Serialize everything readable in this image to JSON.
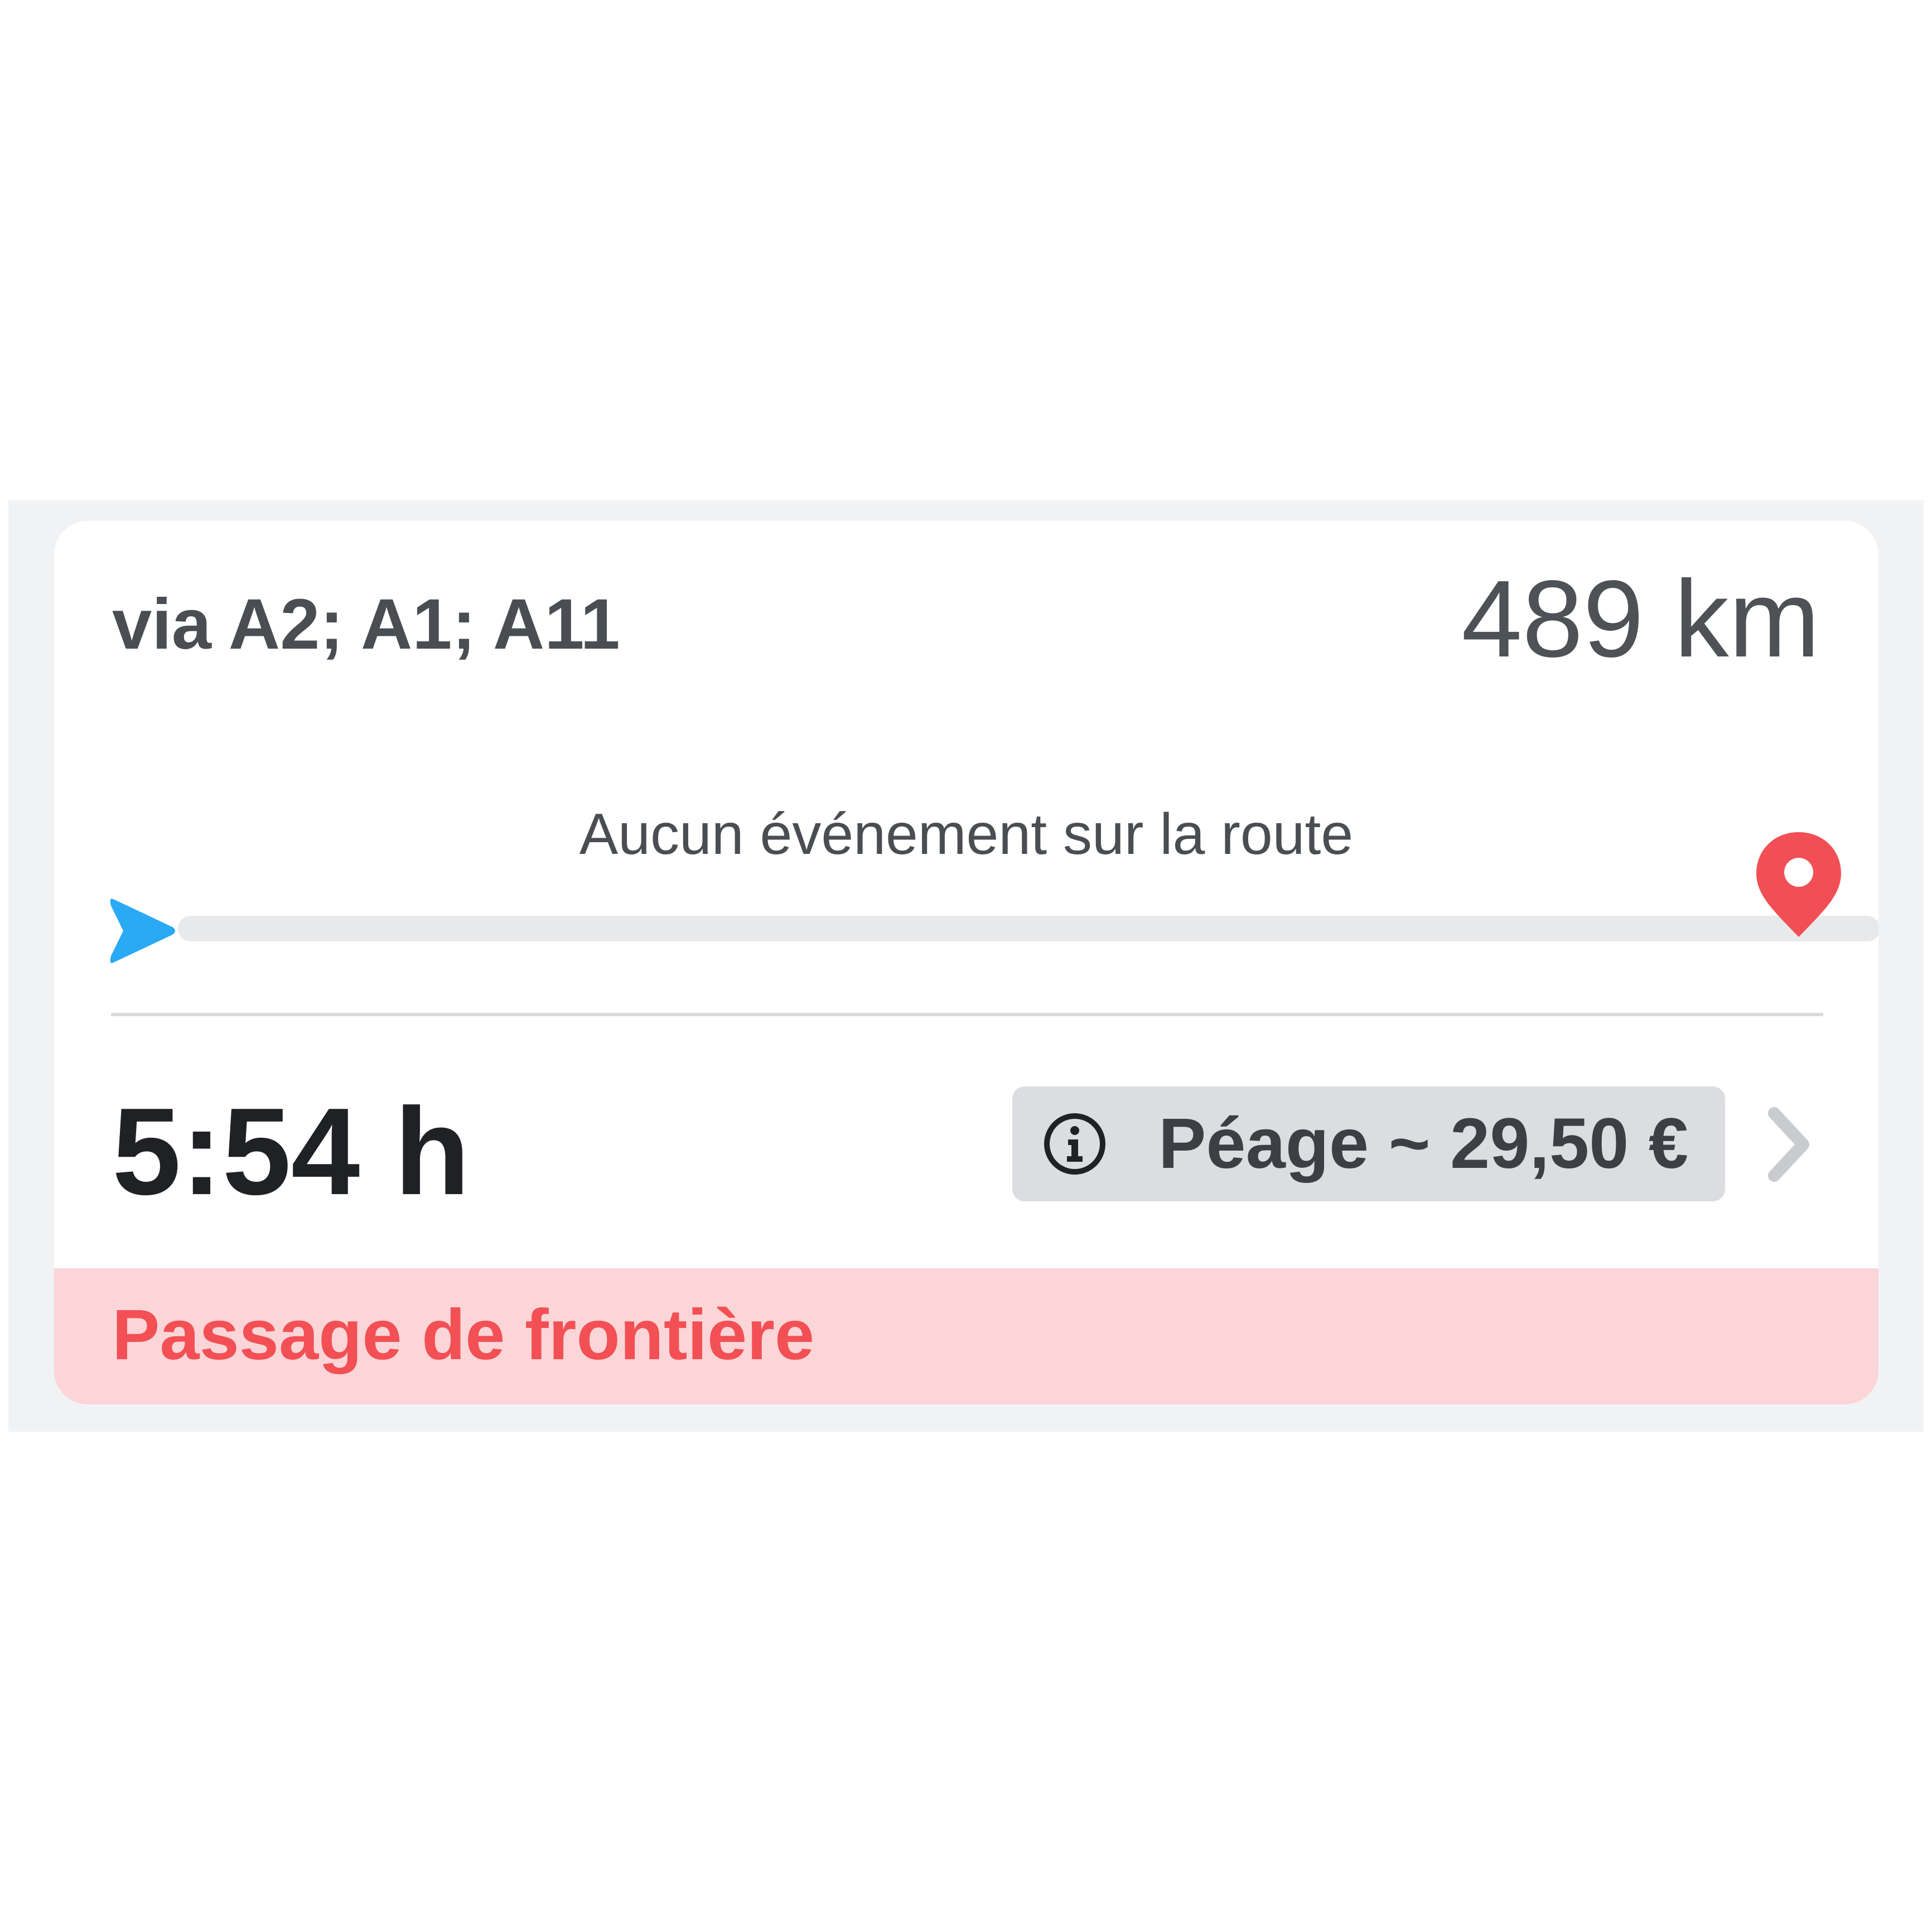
{
  "route": {
    "via": "via A2; A1; A11",
    "distance": "489 km",
    "events_label": "Aucun événement sur la route",
    "duration": "5:54 h",
    "toll_label": "Péage ~ 29,50 €",
    "border_notice": "Passage de frontière"
  },
  "icons": {
    "start": "navigation-arrow-icon",
    "destination": "map-pin-icon",
    "info": "info-icon",
    "chevron": "chevron-right-icon"
  },
  "colors": {
    "start_marker": "#2aa9f4",
    "destination_marker": "#f14f55",
    "border_banner_bg": "#fbd5d7",
    "border_banner_text": "#f25055",
    "toll_chip_bg": "#dcdde0"
  }
}
